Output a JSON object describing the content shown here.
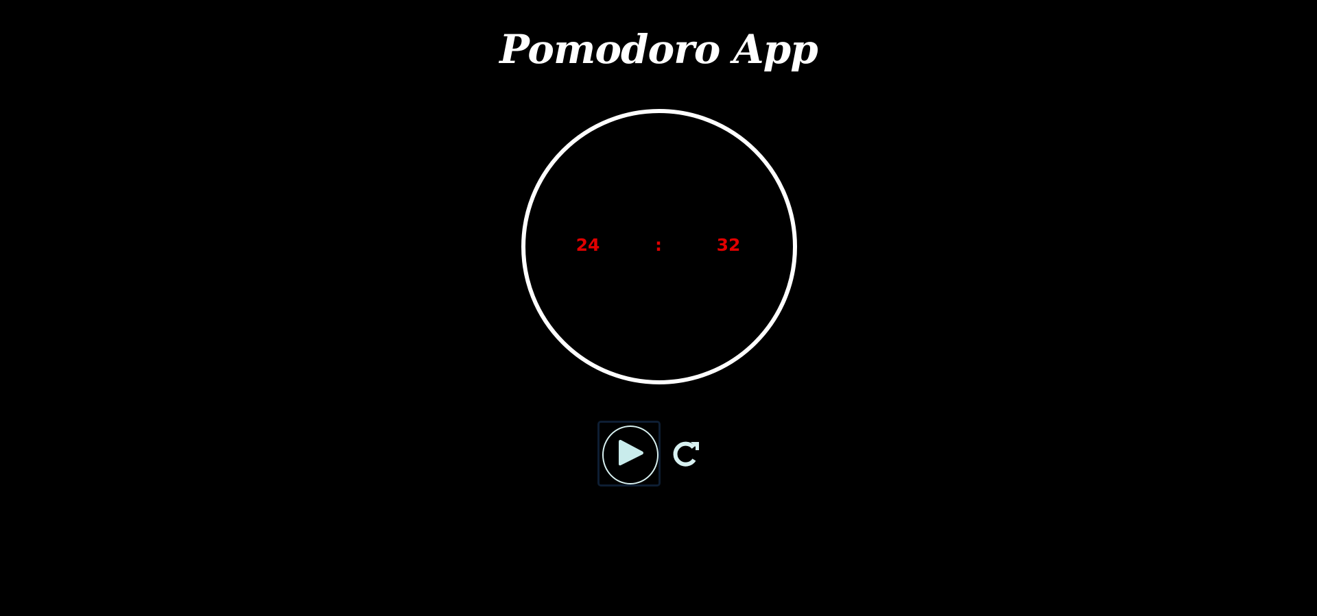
{
  "app": {
    "title": "Pomodoro App"
  },
  "timer": {
    "minutes": "24",
    "separator": ":",
    "seconds": "32"
  },
  "controls": {
    "play_icon": "play-icon",
    "reset_icon": "redo-icon"
  },
  "colors": {
    "background": "#000000",
    "ring": "#ffffff",
    "time_text": "#e00000",
    "icon": "#c9ecec",
    "focus_border": "#0e1e33"
  }
}
